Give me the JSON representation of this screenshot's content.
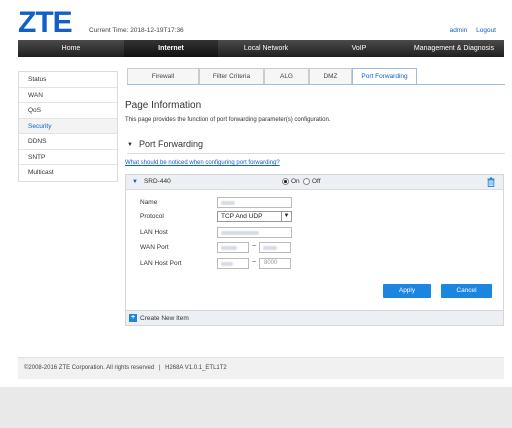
{
  "header": {
    "logo": "ZTE",
    "current_time_label": "Current Time:",
    "current_time_value": "2018-12-19T17:36",
    "admin_link": "admin",
    "logout_link": "Logout"
  },
  "nav": {
    "items": [
      {
        "label": "Home"
      },
      {
        "label": "Internet"
      },
      {
        "label": "Local Network"
      },
      {
        "label": "VoIP"
      },
      {
        "label": "Management & Diagnosis"
      }
    ],
    "active": "Internet"
  },
  "sidebar": {
    "items": [
      {
        "label": "Status"
      },
      {
        "label": "WAN"
      },
      {
        "label": "QoS"
      },
      {
        "label": "Security"
      },
      {
        "label": "DDNS"
      },
      {
        "label": "SNTP"
      },
      {
        "label": "Multicast"
      }
    ],
    "active": "Security"
  },
  "tabs": {
    "items": [
      {
        "label": "Firewall"
      },
      {
        "label": "Filter Criteria"
      },
      {
        "label": "ALG"
      },
      {
        "label": "DMZ"
      },
      {
        "label": "Port Forwarding"
      }
    ],
    "active": "Port Forwarding"
  },
  "page_info": {
    "title": "Page Information",
    "description": "This page provides the function of port forwarding parameter(s) configuration."
  },
  "section": {
    "title": "Port Forwarding",
    "notice_link": "What should be noticed when configuring port forwarding?"
  },
  "rule": {
    "name": "SRD-440",
    "on_label": "On",
    "off_label": "Off",
    "enabled": true,
    "fields": {
      "name_label": "Name",
      "protocol_label": "Protocol",
      "protocol_value": "TCP And UDP",
      "lan_host_label": "LAN Host",
      "wan_port_label": "WAN Port",
      "lan_host_port_label": "LAN Host Port",
      "lan_host_port_end": "8000",
      "range_separator": "~"
    },
    "apply_label": "Apply",
    "cancel_label": "Cancel"
  },
  "create_new": {
    "label": "Create New Item"
  },
  "footer": {
    "copyright": "©2008-2016 ZTE Corporation. All rights reserved",
    "separator": "|",
    "version": "H268A V1.0.1_ETL1T2"
  },
  "colors": {
    "brand": "#1060c8",
    "button": "#1a86e0",
    "navbar": "#2b2b2b"
  }
}
